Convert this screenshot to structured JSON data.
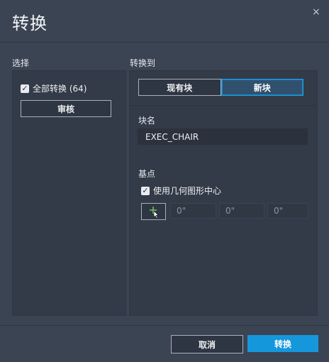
{
  "dialog": {
    "title": "转换",
    "close_icon": "×"
  },
  "left": {
    "label": "选择",
    "convert_all_label": "全部转换 (64)",
    "convert_all_checked": true,
    "review_button": "审核"
  },
  "right": {
    "label": "转换到",
    "tabs": {
      "existing": "现有块",
      "new": "新块",
      "selected": "new"
    },
    "block_name_label": "块名",
    "block_name_value": "EXEC_CHAIR",
    "base_point_label": "基点",
    "use_center_label": "使用几何图形中心",
    "use_center_checked": true,
    "coords": {
      "x": "0\"",
      "y": "0\"",
      "z": "0\""
    }
  },
  "footer": {
    "cancel": "取消",
    "convert": "转换"
  },
  "colors": {
    "accent": "#1597dc",
    "background": "#3b4453"
  }
}
